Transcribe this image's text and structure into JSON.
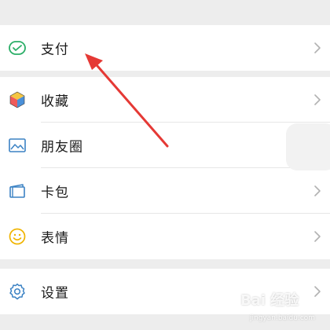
{
  "menu": {
    "pay": {
      "label": "支付",
      "icon": "wallet-check-icon"
    },
    "favorites": {
      "label": "收藏",
      "icon": "cube-icon"
    },
    "moments": {
      "label": "朋友圈",
      "icon": "image-icon"
    },
    "cards": {
      "label": "卡包",
      "icon": "card-wallet-icon"
    },
    "stickers": {
      "label": "表情",
      "icon": "smiley-icon"
    },
    "settings": {
      "label": "设置",
      "icon": "gear-icon"
    }
  },
  "colors": {
    "background": "#ededed",
    "row": "#ffffff",
    "text": "#1a1a1a",
    "chevron": "#b2b2b2",
    "annotation_arrow": "#e53935",
    "pay_icon": "#2aae67",
    "moments_icon": "#3b82c4",
    "cards_icon": "#3b82c4",
    "stickers_icon": "#f0b400",
    "settings_icon": "#3b82c4"
  },
  "watermark": {
    "brand": "Bai 经验",
    "url": "jingyan.baidu.com"
  }
}
